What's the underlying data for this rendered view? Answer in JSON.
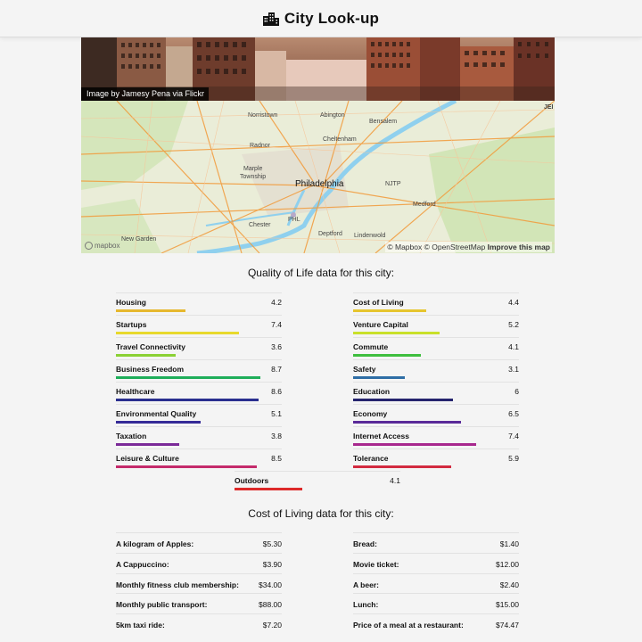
{
  "header": {
    "title": "City Look-up",
    "logo_icon": "city-buildings-icon"
  },
  "hero": {
    "credit": "Image by Jamesy Pena via Flickr"
  },
  "map": {
    "labels": {
      "norristown": "Norristown",
      "abington": "Abington",
      "bensalem": "Bensalem",
      "cheltenham": "Cheltenham",
      "radnor": "Radnor",
      "marple": "Marple",
      "township": "Township",
      "philadelphia": "Philadelphia",
      "njtp": "NJTP",
      "medford": "Medford",
      "chester": "Chester",
      "deptford": "Deptford",
      "lindenwold": "Lindenwold",
      "new_garden": "New Garden",
      "phl": "PHL",
      "jer": "JEI"
    },
    "attribution_prefix": "© Mapbox © OpenStreetMap",
    "attribution_link": "Improve this map",
    "logo_text": "mapbox"
  },
  "quality": {
    "title": "Quality of Life data for this city:",
    "max": 10,
    "items": [
      {
        "name": "Housing",
        "value": "4.2",
        "color": "#e6b82e"
      },
      {
        "name": "Cost of Living",
        "value": "4.4",
        "color": "#e6c52e"
      },
      {
        "name": "Startups",
        "value": "7.4",
        "color": "#e8d92c"
      },
      {
        "name": "Venture Capital",
        "value": "5.2",
        "color": "#c9e02a"
      },
      {
        "name": "Travel Connectivity",
        "value": "3.6",
        "color": "#8bd135"
      },
      {
        "name": "Commute",
        "value": "4.1",
        "color": "#3fbf3f"
      },
      {
        "name": "Business Freedom",
        "value": "8.7",
        "color": "#1fae5a"
      },
      {
        "name": "Safety",
        "value": "3.1",
        "color": "#2f6ea6"
      },
      {
        "name": "Healthcare",
        "value": "8.6",
        "color": "#2a2f8f"
      },
      {
        "name": "Education",
        "value": "6",
        "color": "#25246e"
      },
      {
        "name": "Environmental Quality",
        "value": "5.1",
        "color": "#352a96"
      },
      {
        "name": "Economy",
        "value": "6.5",
        "color": "#5a2a98"
      },
      {
        "name": "Taxation",
        "value": "3.8",
        "color": "#7b2a98"
      },
      {
        "name": "Internet Access",
        "value": "7.4",
        "color": "#a8288e"
      },
      {
        "name": "Leisure & Culture",
        "value": "8.5",
        "color": "#c42a6b"
      },
      {
        "name": "Tolerance",
        "value": "5.9",
        "color": "#d22a40"
      },
      {
        "name": "Outdoors",
        "value": "4.1",
        "color": "#dd2a2a"
      }
    ]
  },
  "cost": {
    "title": "Cost of Living data for this city:",
    "items": [
      {
        "name": "A kilogram of Apples:",
        "value": "$5.30"
      },
      {
        "name": "Bread:",
        "value": "$1.40"
      },
      {
        "name": "A Cappuccino:",
        "value": "$3.90"
      },
      {
        "name": "Movie ticket:",
        "value": "$12.00"
      },
      {
        "name": "Monthly fitness club membership:",
        "value": "$34.00"
      },
      {
        "name": "A beer:",
        "value": "$2.40"
      },
      {
        "name": "Monthly public transport:",
        "value": "$88.00"
      },
      {
        "name": "Lunch:",
        "value": "$15.00"
      },
      {
        "name": "5km taxi ride:",
        "value": "$7.20"
      },
      {
        "name": "Price of a meal at a restaurant:",
        "value": "$74.47"
      }
    ]
  }
}
